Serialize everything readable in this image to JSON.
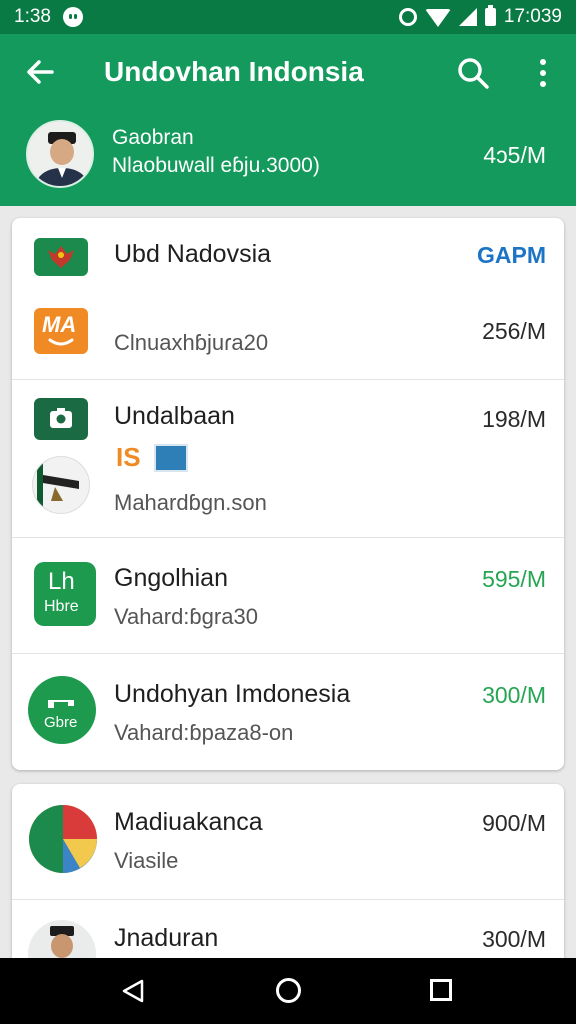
{
  "status_bar": {
    "time": "1:38",
    "clock": "17:039",
    "icons": [
      "notification-icon",
      "alarm-icon",
      "wifi-icon",
      "signal-icon",
      "battery-icon"
    ]
  },
  "app_bar": {
    "title": "Undovhan Indonsia",
    "back_icon": "arrow-back-icon",
    "search_icon": "search-icon",
    "more_icon": "more-vert-icon",
    "profile": {
      "name": "Gaobran",
      "subtitle": "Nlaobuwall eɓju.3000)",
      "amount": "4ɔ5/M"
    }
  },
  "colors": {
    "status_bar": "#0a7a45",
    "app_bar": "#149a5c",
    "accent_green": "#26a553",
    "accent_blue": "#1d74c5",
    "icon_green": "#1c8a4d",
    "icon_orange": "#f08a24"
  },
  "card1": {
    "header": {
      "title": "Ubd Nadovsia",
      "amount": "GAPM",
      "icon": "flag-emblem-icon"
    },
    "rows": [
      {
        "icon": "wallet-smile-icon",
        "icon_text": "MA",
        "subtitle": "Clnuaxhɓjuɾa20",
        "amount": "256/M"
      },
      {
        "icon": "camera-icon",
        "title": "Undalbaan",
        "badge": "IS",
        "subtitle": "Mahardɓgn.son",
        "amount": "198/M"
      },
      {
        "icon": "shop-icon",
        "icon_text": "Lh",
        "icon_sub": "Hbre",
        "title": "Gngolhian",
        "subtitle": "Vahard:ɓgra30",
        "amount": "595/M"
      },
      {
        "icon": "circle-brand-icon",
        "icon_sub": "Gbre",
        "title": "Undohyan Imdonesia",
        "subtitle": "Vahard:ɓpaza8-on",
        "amount": "300/M"
      }
    ]
  },
  "card2": {
    "rows": [
      {
        "icon": "chart-pie-icon",
        "title": "Madiuakanca",
        "subtitle": "Viasile",
        "amount": "900/M"
      },
      {
        "icon": "person-avatar-icon",
        "title": "Jnaduran",
        "amount": "300/M"
      }
    ]
  },
  "nav_bar": {
    "back": "nav-back-icon",
    "home": "nav-home-icon",
    "recents": "nav-recents-icon"
  }
}
